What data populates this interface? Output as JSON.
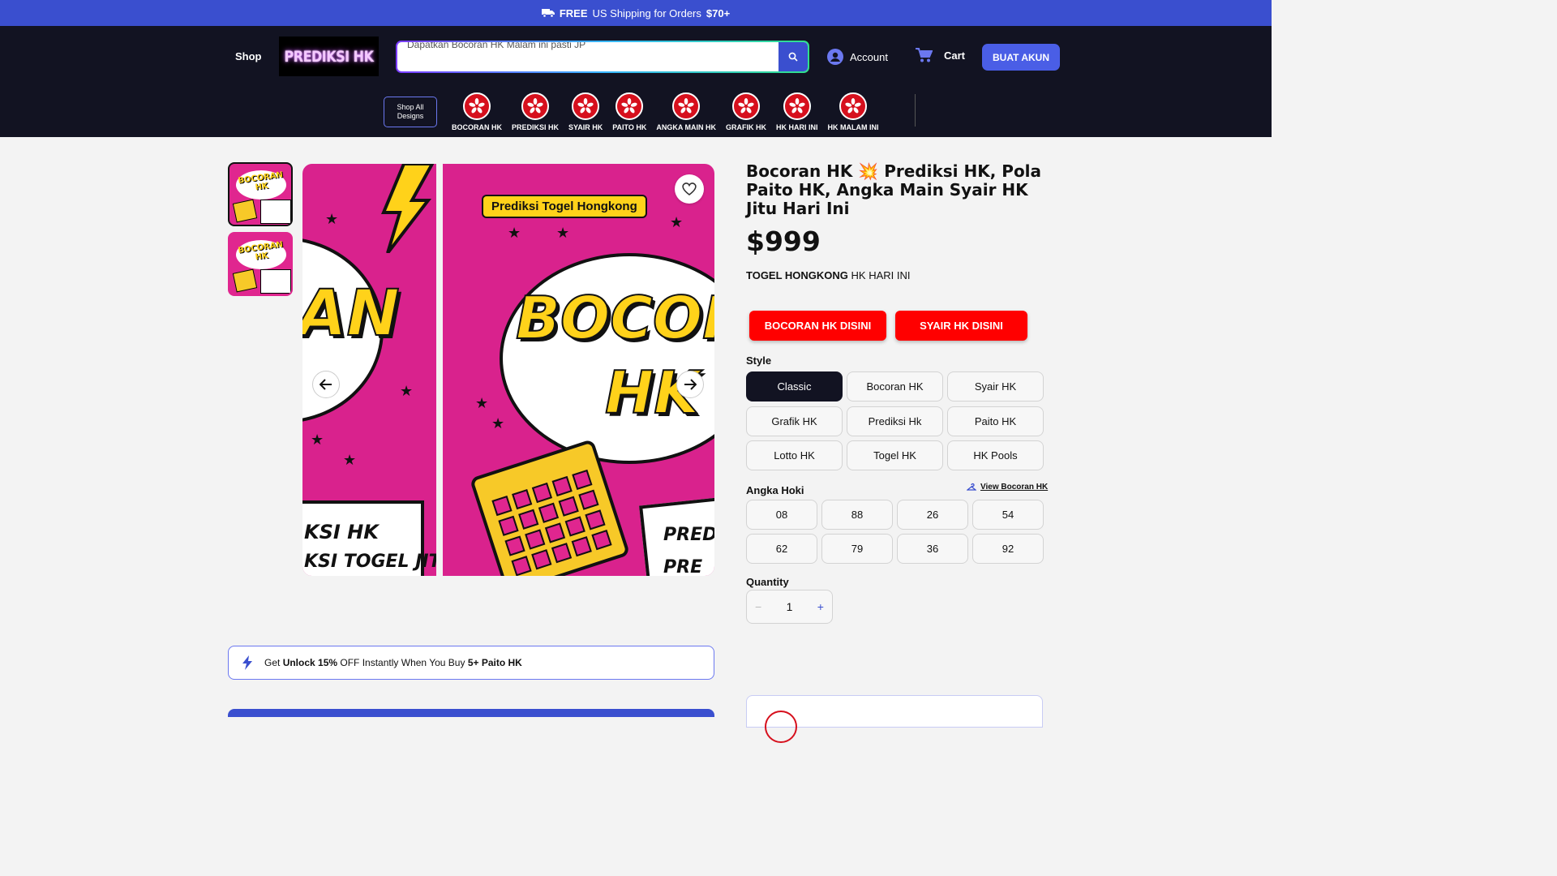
{
  "announcement": {
    "bold": "FREE",
    "text": "US Shipping for Orders",
    "amount": "$70+",
    "icon": "truck-icon"
  },
  "header": {
    "shop_label": "Shop",
    "logo_text": "PREDIKSI HK",
    "search_value": "Dapatkan Bocoran HK Malam ini pasti JP",
    "account_label": "Account",
    "cart_label": "Cart",
    "cta_label": "BUAT AKUN"
  },
  "nav": {
    "shop_all": "Shop All Designs",
    "categories": [
      {
        "label": "BOCORAN HK"
      },
      {
        "label": "PREDIKSI HK"
      },
      {
        "label": "SYAIR HK"
      },
      {
        "label": "PAITO HK"
      },
      {
        "label": "ANGKA MAIN HK"
      },
      {
        "label": "GRAFIK HK"
      },
      {
        "label": "HK HARI INI"
      },
      {
        "label": "HK MALAM INI"
      }
    ]
  },
  "gallery": {
    "pill": "Prediksi Togel Hongkong",
    "big_left": "AN",
    "big_right_1": "BOCORA",
    "big_right_2": "HK",
    "card_left_1": "KSI HK",
    "card_left_2": "KSI TOGEL JITU",
    "card_right_1": "PRED",
    "card_right_2": "PRE",
    "thumb_text": "BOCORAN HK"
  },
  "product": {
    "title": "Bocoran HK 💥 Prediksi HK, Pola Paito HK, Angka Main Syair HK Jitu Hari Ini",
    "price": "$999",
    "subtitle_bold": "TOGEL HONGKONG",
    "subtitle_rest": "HK HARI INI",
    "btn_bocoran": "BOCORAN HK DISINI",
    "btn_syair": "SYAIR HK DISINI",
    "style_label": "Style",
    "styles": [
      "Classic",
      "Bocoran HK",
      "Syair HK",
      "Grafik HK",
      "Prediksi Hk",
      "Paito HK",
      "Lotto HK",
      "Togel HK",
      "HK Pools"
    ],
    "selected_style": "Classic",
    "angka_label": "Angka Hoki",
    "view_link": "View Bocoran HK",
    "numbers": [
      "08",
      "88",
      "26",
      "54",
      "62",
      "79",
      "36",
      "92"
    ],
    "quantity_label": "Quantity",
    "quantity": "1"
  },
  "promo": {
    "prefix": "Get",
    "bold1": "Unlock 15%",
    "middle": "OFF Instantly When You Buy",
    "bold2": "5+ Paito HK"
  },
  "colors": {
    "accent": "#3a4fcf",
    "header_bg": "#121322",
    "red": "#ff0000",
    "magenta": "#d9228d",
    "yellow": "#ffd21a"
  }
}
